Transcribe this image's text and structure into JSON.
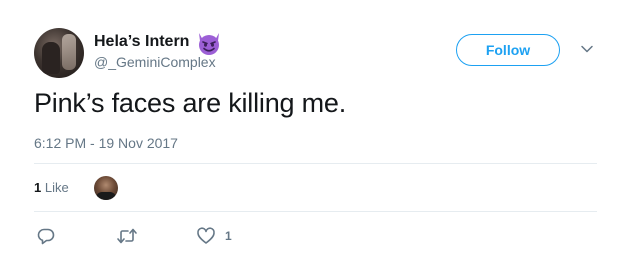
{
  "author": {
    "display_name": "Hela’s Intern",
    "emoji_icon": "smiling-devil-icon",
    "handle": "@_GeminiComplex"
  },
  "follow_label": "Follow",
  "tweet": {
    "text": "Pink’s faces are killing me.",
    "timestamp": "6:12 PM - 19 Nov 2017"
  },
  "stats": {
    "like_count": "1",
    "like_label": "Like"
  },
  "actions": {
    "like_count": "1"
  },
  "colors": {
    "accent": "#1da1f2",
    "secondary_text": "#657786",
    "primary_text": "#14171a",
    "divider": "#e6ecf0",
    "emoji_purple": "#9c5fd6"
  }
}
